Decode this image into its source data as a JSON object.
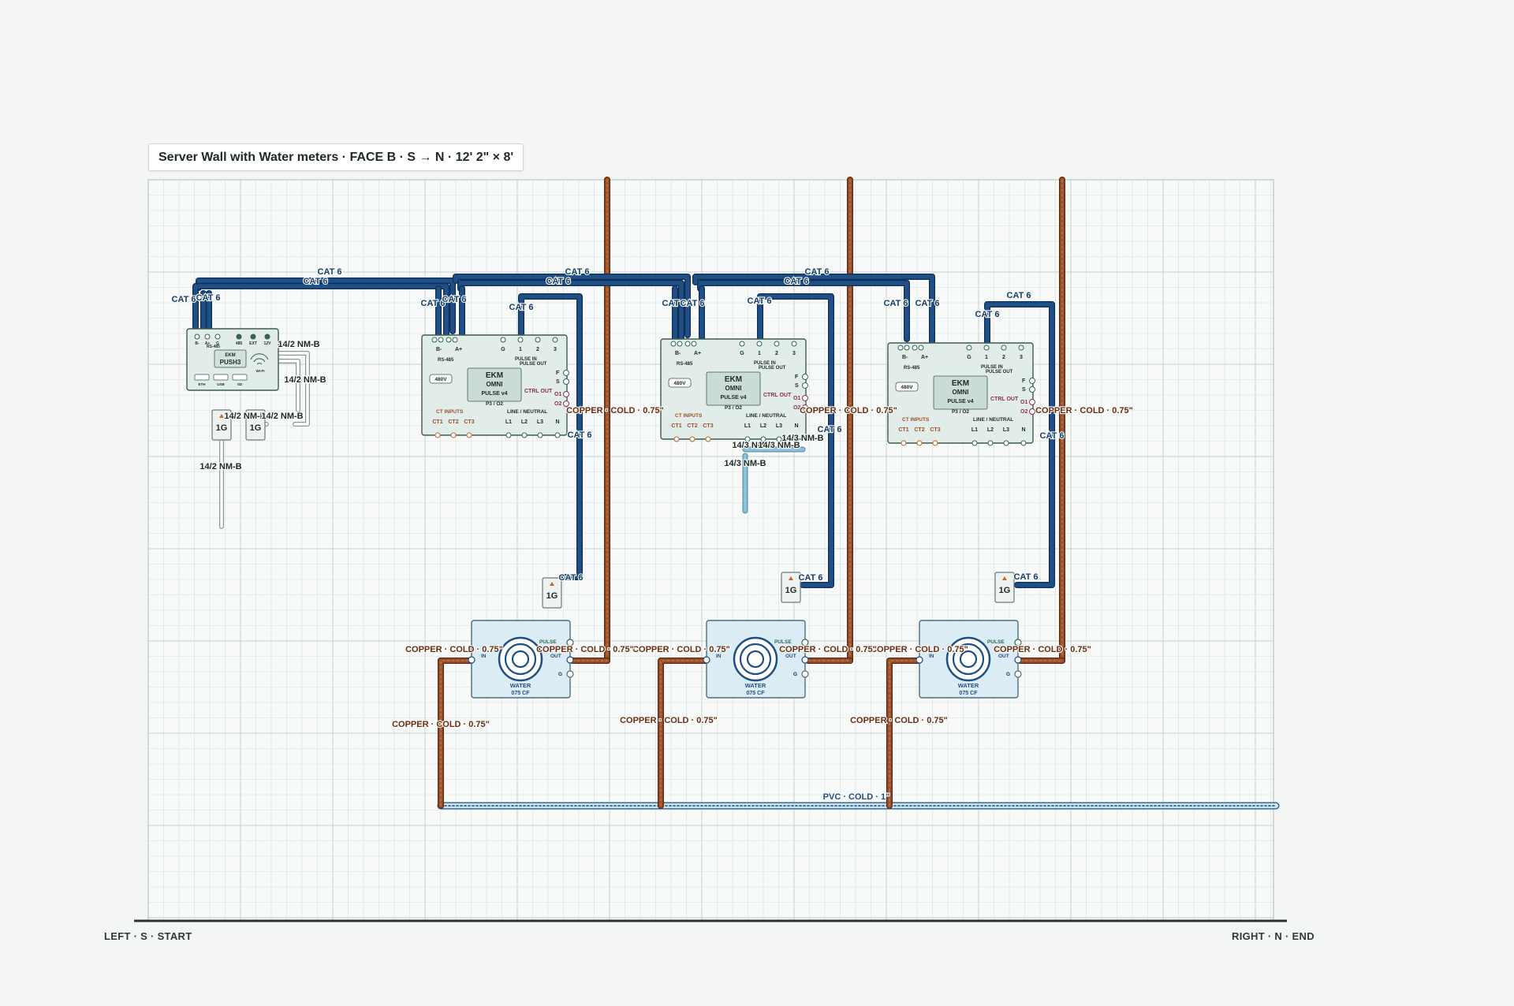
{
  "title": "Server Wall with Water meters · FACE B · S → N · 12' 2\" × 8'",
  "footer": {
    "left": "LEFT · S · START",
    "right": "RIGHT · N · END"
  },
  "colors": {
    "cat6": "#1f4f86",
    "cat6_edge": "#0f2e55",
    "copper": "#9a4f2a",
    "copper_edge": "#5a2a10",
    "nmb": "#ffffff",
    "nmb_edge": "#8f9691",
    "nm14_3": "#8fc2d9",
    "pvc": "#cfe3ee",
    "pvc_edge": "#1e4f80",
    "grid": "#d5e0dc",
    "grid_major": "#c3d1cc",
    "device_fill": "#e2ece8",
    "device_edge": "#3d5a50",
    "meter_fill": "#dcecf4",
    "label_copper": "#6b2e12",
    "label_cat6": "#163c68"
  },
  "push3": {
    "brand": "EKM",
    "model": "PUSH3",
    "top_labels": [
      "B-",
      "A+",
      "G",
      "485",
      "EXT",
      "12V"
    ],
    "bus_label": "RS-485",
    "bottom_labels": [
      "ETH",
      "USB",
      "SD"
    ],
    "wifi_label": "WI-FI"
  },
  "omni": {
    "brand": "EKM",
    "line1": "OMNI",
    "line2": "PULSE v4",
    "phase": "P3 / O2",
    "voltage": "480V",
    "rs485": "RS-485",
    "bus_b": "B-",
    "bus_a": "A+",
    "pulse_terms": [
      "G",
      "1",
      "2",
      "3"
    ],
    "pulse_in": "PULSE IN",
    "pulse_out": "PULSE OUT",
    "fs": [
      "F",
      "S"
    ],
    "ctrl_out": "CTRL OUT",
    "o1": "O1",
    "o2": "O2",
    "ct_inputs": "CT INPUTS",
    "cts": [
      "CT1",
      "CT2",
      "CT3"
    ],
    "line_neutral": "LINE / NEUTRAL",
    "lines": [
      "L1",
      "L2",
      "L3",
      "N"
    ]
  },
  "meter": {
    "in": "IN",
    "out": "OUT",
    "pulse": "PULSE",
    "g": "G",
    "line1": "WATER",
    "line2": "075 CF"
  },
  "box_label": "1G",
  "wire_labels": [
    "CAT 6",
    "CAT 6",
    "CAT 6",
    "CAT 6",
    "CAT 6",
    "CAT 6",
    "CAT 6",
    "CAT 6",
    "CAT 6",
    "CAT 6",
    "CAT 6",
    "CAT 6",
    "CAT 6",
    "CAT 6",
    "CAT 6",
    "CAT 6",
    "CAT 6",
    "CAT 6",
    "CAT 6",
    "CAT 6",
    "CAT 6",
    "CAT 6",
    "CAT 6",
    "CAT 6",
    "14/2 NM-B",
    "14/2 NM-B",
    "14/2 NM-B",
    "14/2 NM-B",
    "14/2 NM-B",
    "14/3 NM-B",
    "14/3 NM-B",
    "14/3 NM-B",
    "14/3 NM-B",
    "COPPER · COLD · 0.75\"",
    "COPPER · COLD · 0.75\"",
    "COPPER · COLD · 0.75\"",
    "COPPER · COLD · 0.75\"",
    "COPPER · COLD · 0.75\"",
    "COPPER · COLD · 0.75\"",
    "COPPER · COLD · 0.75\"",
    "COPPER · COLD · 0.75\"",
    "COPPER · COLD · 0.75\"",
    "COPPER · COLD · 0.75\"",
    "COPPER · COLD · 0.75\"",
    "COPPER · COLD · 0.75\"",
    "PVC · COLD · 1\""
  ]
}
